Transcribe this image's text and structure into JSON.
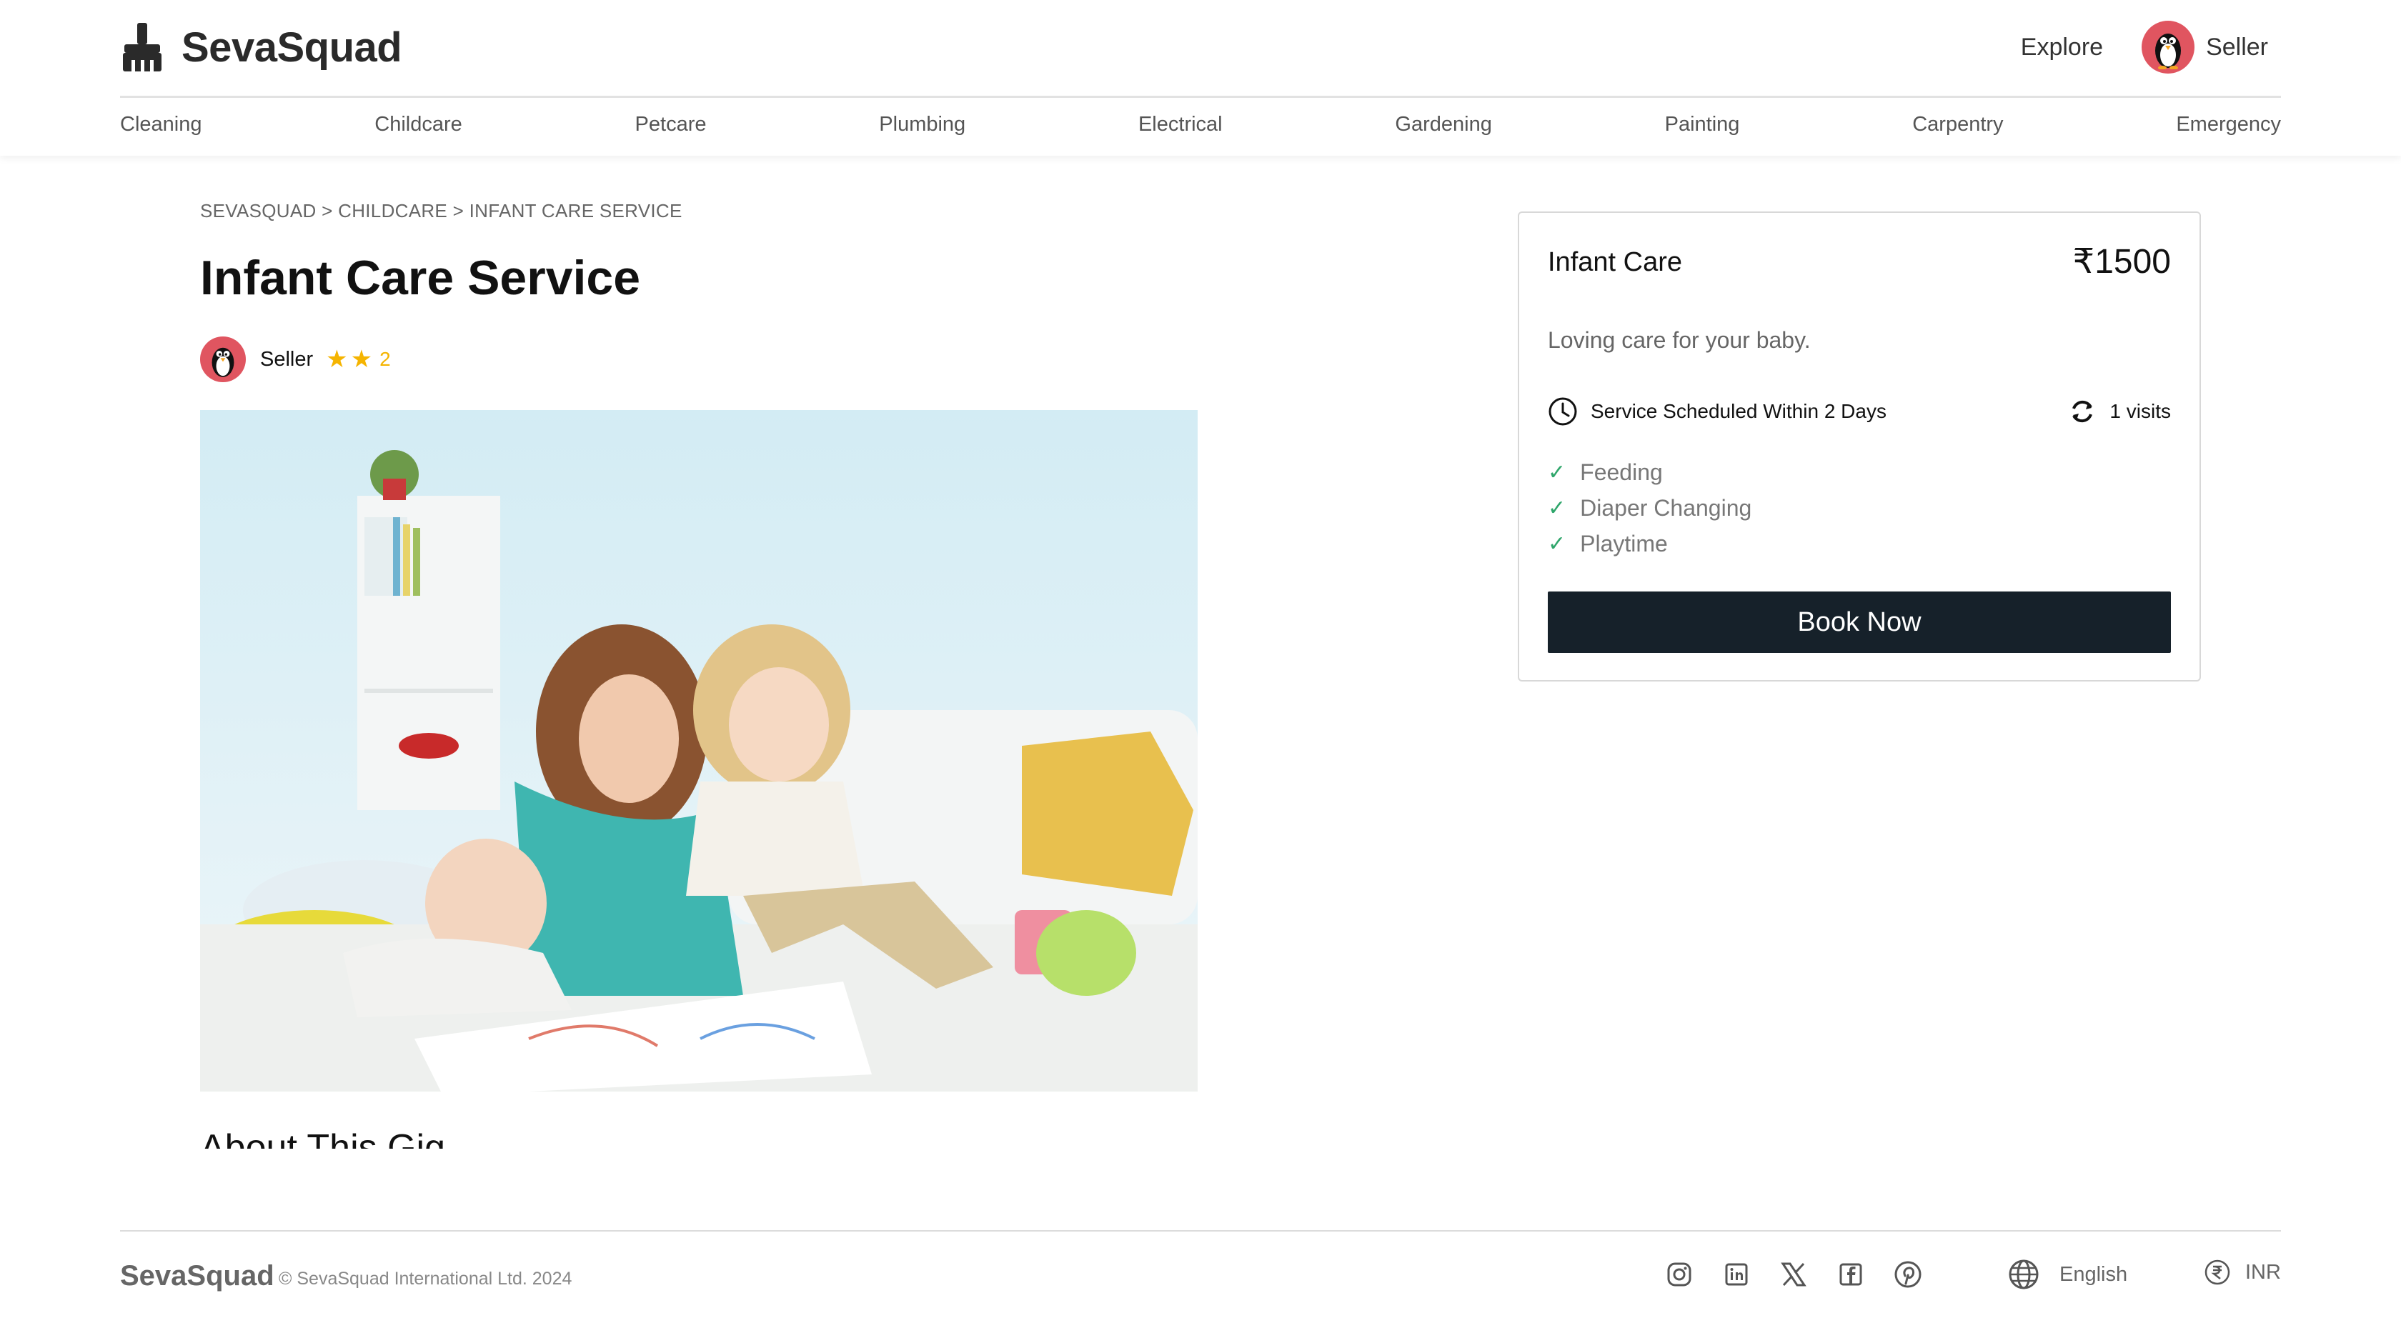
{
  "header": {
    "brand": "SevaSquad",
    "explore_label": "Explore",
    "user_label": "Seller",
    "categories": [
      "Cleaning",
      "Childcare",
      "Petcare",
      "Plumbing",
      "Electrical",
      "Gardening",
      "Painting",
      "Carpentry",
      "Emergency"
    ]
  },
  "breadcrumb": "SEVASQUAD > CHILDCARE > INFANT CARE SERVICE",
  "gig": {
    "title": "Infant Care Service",
    "seller_name": "Seller",
    "rating": "2",
    "about_heading": "About This Gig"
  },
  "card": {
    "title": "Infant Care",
    "price": "₹1500",
    "description": "Loving care for your baby.",
    "schedule": "Service Scheduled Within 2 Days",
    "visits": "1 visits",
    "features": [
      "Feeding",
      "Diaper Changing",
      "Playtime"
    ],
    "book_label": "Book Now"
  },
  "footer": {
    "brand": "SevaSquad",
    "copyright": "© SevaSquad International Ltd. 2024",
    "language": "English",
    "currency": "INR",
    "socials": [
      "instagram-icon",
      "linkedin-icon",
      "x-icon",
      "facebook-icon",
      "pinterest-icon"
    ]
  },
  "colors": {
    "accent_dark": "#16212a",
    "star": "#f5b400",
    "check": "#2fa66b",
    "avatar_bg": "#e05560"
  }
}
